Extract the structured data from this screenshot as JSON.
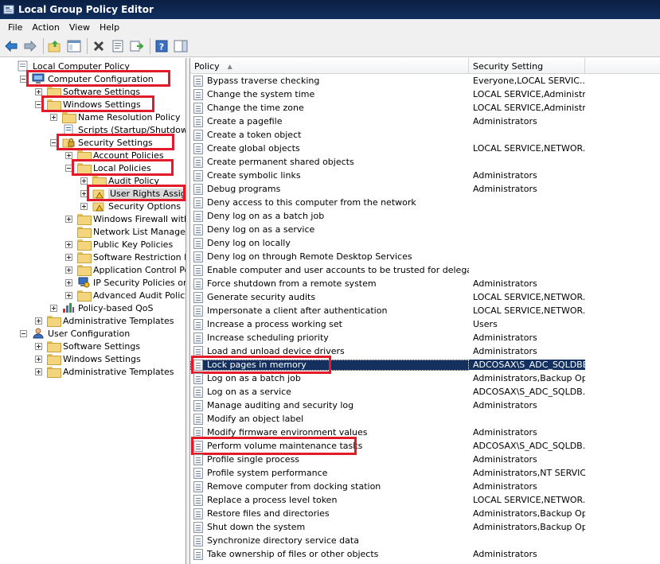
{
  "window": {
    "title": "Local Group Policy Editor"
  },
  "menu": [
    "File",
    "Action",
    "View",
    "Help"
  ],
  "toolbar": {
    "icons": [
      "back-arrow-icon",
      "forward-arrow-icon",
      "up-folder-icon",
      "show-hide-tree-icon",
      "delete-icon",
      "properties-icon",
      "export-list-icon",
      "help-icon",
      "action-pane-icon"
    ]
  },
  "tree": [
    {
      "label": "Local Computer Policy",
      "level": 0,
      "expander": "none",
      "icon": "policy"
    },
    {
      "label": "Computer Configuration",
      "level": 1,
      "expander": "minus",
      "icon": "computer",
      "highlight": true
    },
    {
      "label": "Software Settings",
      "level": 2,
      "expander": "plus",
      "icon": "folder"
    },
    {
      "label": "Windows Settings",
      "level": 2,
      "expander": "minus",
      "icon": "folder",
      "highlight": true
    },
    {
      "label": "Name Resolution Policy",
      "level": 3,
      "expander": "plus",
      "icon": "folder"
    },
    {
      "label": "Scripts (Startup/Shutdown)",
      "level": 3,
      "expander": "none",
      "icon": "script"
    },
    {
      "label": "Security Settings",
      "level": 3,
      "expander": "minus",
      "icon": "security",
      "highlight": true
    },
    {
      "label": "Account Policies",
      "level": 4,
      "expander": "plus",
      "icon": "folder"
    },
    {
      "label": "Local Policies",
      "level": 4,
      "expander": "minus",
      "icon": "folder",
      "highlight": true
    },
    {
      "label": "Audit Policy",
      "level": 5,
      "expander": "plus",
      "icon": "folder"
    },
    {
      "label": "User Rights Assignment",
      "level": 5,
      "expander": "plus",
      "icon": "folder-lock",
      "highlight": true,
      "selected": true
    },
    {
      "label": "Security Options",
      "level": 5,
      "expander": "plus",
      "icon": "folder-lock"
    },
    {
      "label": "Windows Firewall with Advanced Security",
      "level": 4,
      "expander": "plus",
      "icon": "folder"
    },
    {
      "label": "Network List Manager Policies",
      "level": 4,
      "expander": "none",
      "icon": "folder"
    },
    {
      "label": "Public Key Policies",
      "level": 4,
      "expander": "plus",
      "icon": "folder"
    },
    {
      "label": "Software Restriction Policies",
      "level": 4,
      "expander": "plus",
      "icon": "folder"
    },
    {
      "label": "Application Control Policies",
      "level": 4,
      "expander": "plus",
      "icon": "folder"
    },
    {
      "label": "IP Security Policies on Local Computer",
      "level": 4,
      "expander": "plus",
      "icon": "ipsec"
    },
    {
      "label": "Advanced Audit Policy Configuration",
      "level": 4,
      "expander": "plus",
      "icon": "folder"
    },
    {
      "label": "Policy-based QoS",
      "level": 3,
      "expander": "plus",
      "icon": "chart"
    },
    {
      "label": "Administrative Templates",
      "level": 2,
      "expander": "plus",
      "icon": "folder"
    },
    {
      "label": "User Configuration",
      "level": 1,
      "expander": "minus",
      "icon": "user"
    },
    {
      "label": "Software Settings",
      "level": 2,
      "expander": "plus",
      "icon": "folder"
    },
    {
      "label": "Windows Settings",
      "level": 2,
      "expander": "plus",
      "icon": "folder"
    },
    {
      "label": "Administrative Templates",
      "level": 2,
      "expander": "plus",
      "icon": "folder"
    }
  ],
  "list": {
    "columns": {
      "policy": "Policy",
      "setting": "Security Setting"
    },
    "rows": [
      {
        "policy": "Bypass traverse checking",
        "setting": "Everyone,LOCAL SERVIC..."
      },
      {
        "policy": "Change the system time",
        "setting": "LOCAL SERVICE,Administr..."
      },
      {
        "policy": "Change the time zone",
        "setting": "LOCAL SERVICE,Administr..."
      },
      {
        "policy": "Create a pagefile",
        "setting": "Administrators"
      },
      {
        "policy": "Create a token object",
        "setting": ""
      },
      {
        "policy": "Create global objects",
        "setting": "LOCAL SERVICE,NETWOR..."
      },
      {
        "policy": "Create permanent shared objects",
        "setting": ""
      },
      {
        "policy": "Create symbolic links",
        "setting": "Administrators"
      },
      {
        "policy": "Debug programs",
        "setting": "Administrators"
      },
      {
        "policy": "Deny access to this computer from the network",
        "setting": ""
      },
      {
        "policy": "Deny log on as a batch job",
        "setting": ""
      },
      {
        "policy": "Deny log on as a service",
        "setting": ""
      },
      {
        "policy": "Deny log on locally",
        "setting": ""
      },
      {
        "policy": "Deny log on through Remote Desktop Services",
        "setting": ""
      },
      {
        "policy": "Enable computer and user accounts to be trusted for delegation",
        "setting": ""
      },
      {
        "policy": "Force shutdown from a remote system",
        "setting": "Administrators"
      },
      {
        "policy": "Generate security audits",
        "setting": "LOCAL SERVICE,NETWOR..."
      },
      {
        "policy": "Impersonate a client after authentication",
        "setting": "LOCAL SERVICE,NETWOR..."
      },
      {
        "policy": "Increase a process working set",
        "setting": "Users"
      },
      {
        "policy": "Increase scheduling priority",
        "setting": "Administrators"
      },
      {
        "policy": "Load and unload device drivers",
        "setting": "Administrators"
      },
      {
        "policy": "Lock pages in memory",
        "setting": "ADCOSAX\\S_ADC_SQLDBE",
        "selected": true,
        "highlight": true
      },
      {
        "policy": "Log on as a batch job",
        "setting": "Administrators,Backup Op..."
      },
      {
        "policy": "Log on as a service",
        "setting": "ADCOSAX\\S_ADC_SQLDB..."
      },
      {
        "policy": "Manage auditing and security log",
        "setting": "Administrators"
      },
      {
        "policy": "Modify an object label",
        "setting": ""
      },
      {
        "policy": "Modify firmware environment values",
        "setting": "Administrators"
      },
      {
        "policy": "Perform volume maintenance tasks",
        "setting": "ADCOSAX\\S_ADC_SQLDB...",
        "highlight": true
      },
      {
        "policy": "Profile single process",
        "setting": "Administrators"
      },
      {
        "policy": "Profile system performance",
        "setting": "Administrators,NT SERVIC..."
      },
      {
        "policy": "Remove computer from docking station",
        "setting": "Administrators"
      },
      {
        "policy": "Replace a process level token",
        "setting": "LOCAL SERVICE,NETWOR..."
      },
      {
        "policy": "Restore files and directories",
        "setting": "Administrators,Backup Op..."
      },
      {
        "policy": "Shut down the system",
        "setting": "Administrators,Backup Op..."
      },
      {
        "policy": "Synchronize directory service data",
        "setting": ""
      },
      {
        "policy": "Take ownership of files or other objects",
        "setting": "Administrators"
      }
    ]
  },
  "colors": {
    "highlight": "#e21a2a",
    "selection": "#14305f",
    "titlebar": "#0c1f43"
  }
}
